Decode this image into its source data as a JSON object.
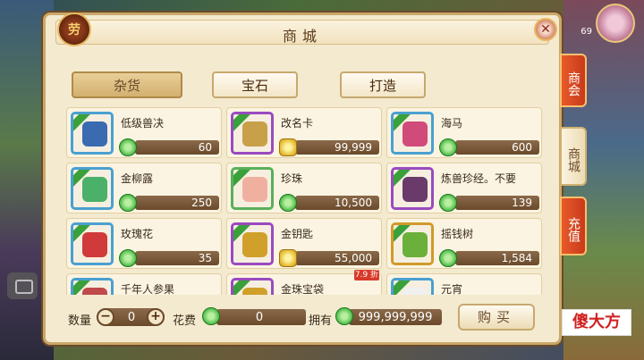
{
  "title": "商城",
  "logo_text": "劳",
  "close_text": "✕",
  "level_text": "69",
  "categories": [
    {
      "label": "杂货"
    },
    {
      "label": "宝石"
    },
    {
      "label": "打造"
    }
  ],
  "side_tabs": [
    {
      "label": "商会"
    },
    {
      "label": "商城"
    },
    {
      "label": "充值"
    }
  ],
  "items": [
    {
      "name": "低级兽决",
      "price": "60",
      "currency": "green-coin",
      "frame": "blue",
      "icon_color": "#3a6ab0"
    },
    {
      "name": "改名卡",
      "price": "99,999",
      "currency": "gold-ingot",
      "frame": "purple",
      "icon_color": "#c8a04a"
    },
    {
      "name": "海马",
      "price": "600",
      "currency": "green-coin",
      "frame": "blue",
      "icon_color": "#d04a7a"
    },
    {
      "name": "金柳露",
      "price": "250",
      "currency": "green-coin",
      "frame": "blue",
      "icon_color": "#4ab06a"
    },
    {
      "name": "珍珠",
      "price": "10,500",
      "currency": "green-coin",
      "frame": "green",
      "icon_color": "#f0b0a0"
    },
    {
      "name": "炼兽珍经。不要",
      "price": "139",
      "currency": "green-coin",
      "frame": "purple",
      "icon_color": "#6a3a6a"
    },
    {
      "name": "玫瑰花",
      "price": "35",
      "currency": "green-coin",
      "frame": "blue",
      "icon_color": "#d03a3a"
    },
    {
      "name": "金钥匙",
      "price": "55,000",
      "currency": "gold-ingot",
      "frame": "purple",
      "icon_color": "#d0a02a"
    },
    {
      "name": "摇钱树",
      "price": "1,584",
      "currency": "green-coin",
      "frame": "gold",
      "icon_color": "#6ab03a"
    },
    {
      "name": "千年人参果",
      "price": "",
      "currency": "green-coin",
      "frame": "blue",
      "icon_color": "#c04a4a"
    },
    {
      "name": "金珠宝袋",
      "price": "",
      "currency": "green-coin",
      "frame": "purple",
      "icon_color": "#d0a02a"
    },
    {
      "name": "元宵",
      "price": "",
      "currency": "green-coin",
      "frame": "blue",
      "icon_color": "#f0f0f0"
    }
  ],
  "discount_badge": "7.9 折",
  "bottom": {
    "qty_label": "数量",
    "qty_minus": "−",
    "qty_value": "0",
    "qty_plus": "+",
    "fee_label": "花费",
    "fee_value": "0",
    "own_label": "拥有",
    "own_value": "999,999,999",
    "buy_label": "购买"
  },
  "watermark": "傻大方"
}
